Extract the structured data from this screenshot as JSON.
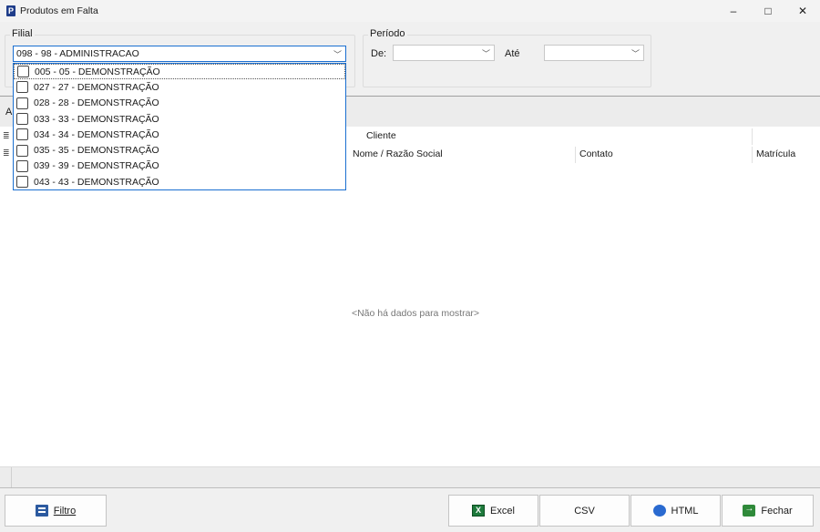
{
  "window": {
    "title": "Produtos em Falta",
    "controls": {
      "minimize": "–",
      "maximize": "□",
      "close": "✕"
    }
  },
  "filial": {
    "label": "Filial",
    "selected": "098 - 98 - ADMINISTRACAO",
    "options": [
      "005 - 05 - DEMONSTRAÇÃO",
      "027 - 27 - DEMONSTRAÇÃO",
      "028 - 28 - DEMONSTRAÇÃO",
      "033 - 33 - DEMONSTRAÇÃO",
      "034 - 34 - DEMONSTRAÇÃO",
      "035 - 35 - DEMONSTRAÇÃO",
      "039 - 39 - DEMONSTRAÇÃO",
      "043 - 43 - DEMONSTRAÇÃO"
    ]
  },
  "periodo": {
    "label": "Período",
    "from_label": "De:",
    "from_value": "",
    "to_label": "Até",
    "to_value": ""
  },
  "grid": {
    "group_panel_text": "A",
    "band_cliente": "Cliente",
    "columns": [
      "Nome / Razão Social",
      "Contato",
      "Matrícula"
    ],
    "empty_text": "<Não há dados para mostrar>"
  },
  "buttons": {
    "filtro": "Filtro",
    "excel": "Excel",
    "csv": "CSV",
    "html": "HTML",
    "fechar": "Fechar"
  }
}
